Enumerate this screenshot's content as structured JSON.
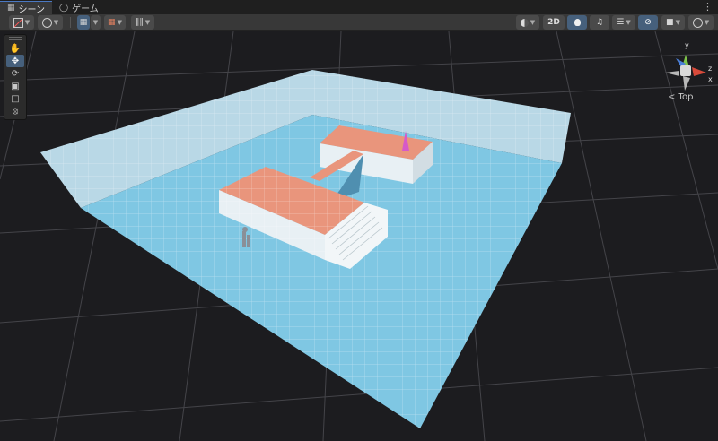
{
  "tabs": [
    {
      "label": "シーン",
      "icon": "grid-icon",
      "active": true
    },
    {
      "label": "ゲーム",
      "icon": "gamepad-icon",
      "active": false
    }
  ],
  "toolbar": {
    "mode_2d_label": "2D",
    "icons": [
      "draw-mode-icon",
      "render-paths-icon",
      "snap-grid-icon",
      "increment-snap-icon",
      "pivot-icon",
      "orientation-icon",
      "light-bulb-icon",
      "audio-icon",
      "effects-icon",
      "hidden-objects-icon",
      "camera-icon",
      "gizmos-icon"
    ]
  },
  "tools": [
    "hand-tool",
    "move-tool",
    "rotate-tool",
    "scale-tool",
    "rect-tool",
    "transform-tool"
  ],
  "gizmo": {
    "view_label": "< Top",
    "axis_y": "y",
    "axis_x": "x",
    "axis_z": "z"
  },
  "colors": {
    "accent": "#46607c",
    "floor": "#7fc7e3",
    "platform_top": "#e9957c",
    "grid_line": "#cfd5d8"
  }
}
